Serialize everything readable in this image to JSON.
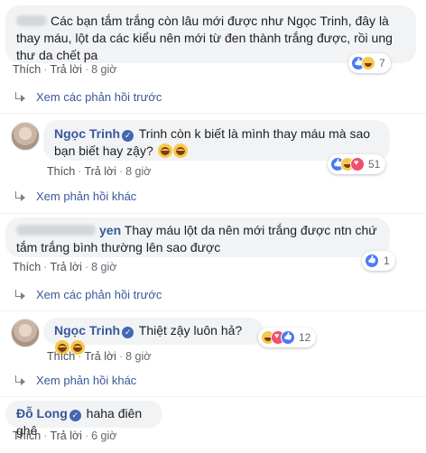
{
  "comments": [
    {
      "id": "c1",
      "author": "",
      "text": "Các bạn tắm trắng còn lâu mới được như Ngọc Trinh, đây là thay máu, lột da các kiểu nên mới từ đen thành trắng được, rồi ung thư da chết pa",
      "reactions": {
        "icons": [
          "like",
          "haha"
        ],
        "count": "7"
      },
      "actions": {
        "like": "Thích",
        "reply": "Trả lời",
        "time": "8 giờ"
      },
      "more": "Xem các phản hồi trước"
    },
    {
      "id": "c1r",
      "author": "Ngọc Trinh",
      "text": "Trinh còn k biết là mình thay máu mà sao bạn biết hay zậy? ",
      "reactions": {
        "icons": [
          "like",
          "haha",
          "love"
        ],
        "count": "51"
      },
      "actions": {
        "like": "Thích",
        "reply": "Trả lời",
        "time": "8 giờ"
      },
      "more": "Xem phản hồi khác"
    },
    {
      "id": "c2",
      "author": "yen",
      "text": "Thay máu lột da nên mới trắng được ntn chứ tắm trắng bình thường lên sao được",
      "reactions": {
        "icons": [
          "like"
        ],
        "count": "1"
      },
      "actions": {
        "like": "Thích",
        "reply": "Trả lời",
        "time": "8 giờ"
      },
      "more": "Xem các phản hồi trước"
    },
    {
      "id": "c2r",
      "author": "Ngọc Trinh",
      "text": "Thiệt zậy luôn hả?",
      "reactions": {
        "icons": [
          "haha",
          "love",
          "like"
        ],
        "count": "12"
      },
      "actions": {
        "like": "Thích",
        "reply": "Trả lời",
        "time": "8 giờ"
      },
      "more": "Xem phản hồi khác"
    },
    {
      "id": "c3",
      "author": "Đỗ Long",
      "text": "haha điên ghê",
      "reactions": null,
      "actions": {
        "like": "Thích",
        "reply": "Trả lời",
        "time": "6 giờ"
      },
      "more": ""
    }
  ],
  "colors": {
    "link": "#385898",
    "bubble": "#f2f3f5",
    "meta": "#606770"
  }
}
